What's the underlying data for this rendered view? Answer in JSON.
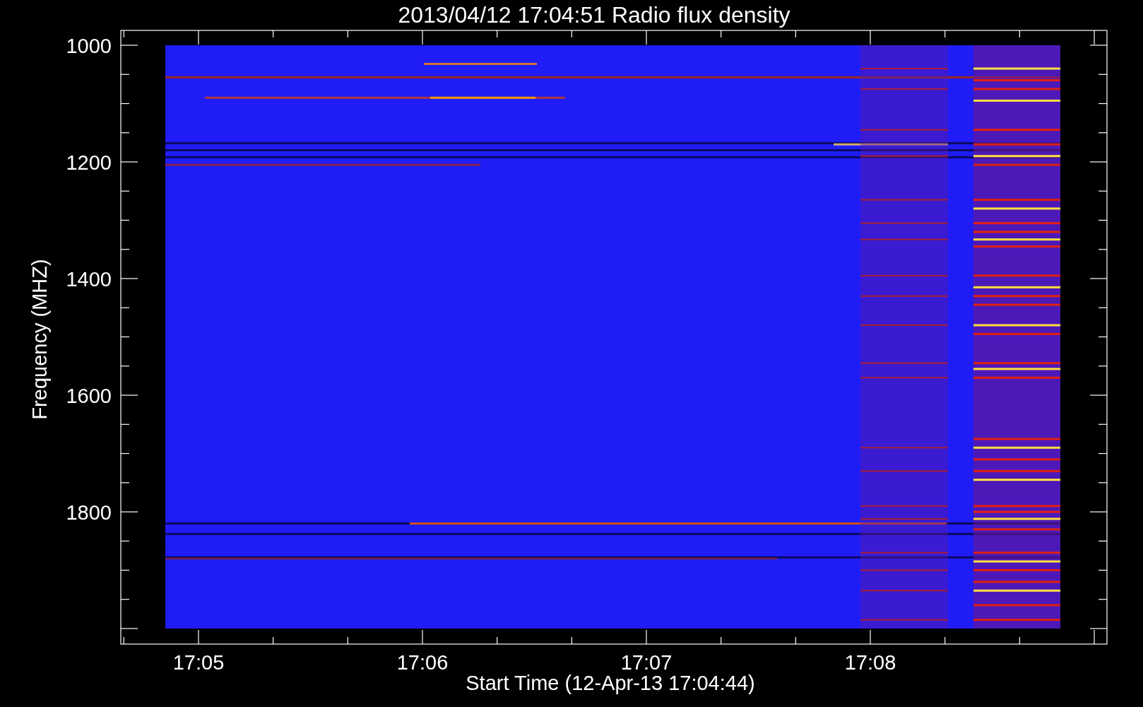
{
  "title": "2013/04/12 17:04:51 Radio flux density",
  "y_axis": {
    "label": "Frequency (MHZ)",
    "ticks": [
      "1000",
      "1200",
      "1400",
      "1600",
      "1800"
    ]
  },
  "x_axis": {
    "label": "Start Time (12-Apr-13 17:04:44)",
    "ticks": [
      "17:05",
      "17:06",
      "17:07",
      "17:08"
    ]
  }
}
